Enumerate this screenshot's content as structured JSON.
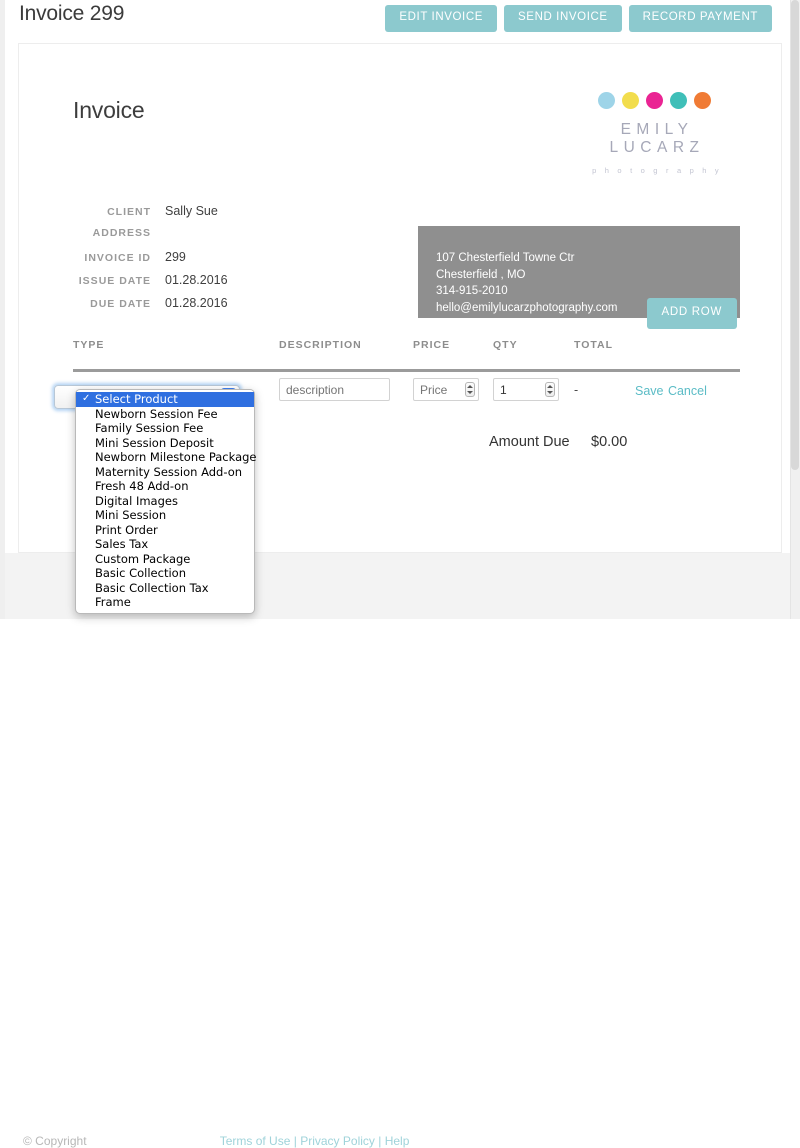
{
  "header": {
    "title": "Invoice 299",
    "actions": [
      {
        "label": "EDIT INVOICE",
        "name": "edit-invoice-button"
      },
      {
        "label": "SEND INVOICE",
        "name": "send-invoice-button"
      },
      {
        "label": "RECORD PAYMENT",
        "name": "record-payment-button"
      }
    ]
  },
  "invoice": {
    "heading": "Invoice",
    "logo": {
      "name": "EMILY LUCARZ",
      "tagline": "p h o t o g r a p h y",
      "dot_colors": [
        "#9ed4e8",
        "#f2dd4d",
        "#ea2493",
        "#3fbfb8",
        "#f07b35"
      ]
    },
    "meta": [
      {
        "label": "CLIENT",
        "value": "Sally Sue"
      },
      {
        "label": "ADDRESS",
        "value": ""
      },
      {
        "label": "INVOICE ID",
        "value": "299"
      },
      {
        "label": "ISSUE DATE",
        "value": "01.28.2016"
      },
      {
        "label": "DUE DATE",
        "value": "01.28.2016"
      }
    ],
    "business_address": {
      "line1": "107 Chesterfield Towne Ctr",
      "line2": "Chesterfield , MO",
      "line3": "314-915-2010",
      "line4": "hello@emilylucarzphotography.com"
    },
    "add_row_label": "ADD ROW",
    "table": {
      "columns": [
        "TYPE",
        "DESCRIPTION",
        "PRICE",
        "QTY",
        "TOTAL"
      ],
      "row": {
        "description_placeholder": "description",
        "price_placeholder": "Price",
        "price_value": "",
        "qty_value": "1",
        "total": "-",
        "save_label": "Save",
        "cancel_label": "Cancel"
      }
    },
    "amount_due": {
      "label": "Amount Due",
      "value": "$0.00"
    }
  },
  "product_select": {
    "selected": "Select Product",
    "options": [
      "Select Product",
      "Newborn Session Fee",
      "Family Session Fee",
      "Mini Session Deposit",
      "Newborn Milestone Package",
      "Maternity Session Add-on",
      "Fresh 48 Add-on",
      "Digital Images",
      "Mini Session",
      "Print Order",
      "Sales Tax",
      "Custom Package",
      "Basic Collection",
      "Basic Collection Tax",
      "Frame"
    ],
    "check_glyph": "✓"
  },
  "footer": {
    "copyright": "© Copyright",
    "links": [
      {
        "label": "Terms of Use"
      },
      {
        "label": "Privacy Policy"
      },
      {
        "label": "Help"
      }
    ],
    "separator": "|"
  },
  "colors": {
    "teal_button": "#8cc9ce",
    "teal_link": "#5bbcc6",
    "address_box": "#8f8f8f",
    "highlight_blue": "#2f6fe0"
  }
}
